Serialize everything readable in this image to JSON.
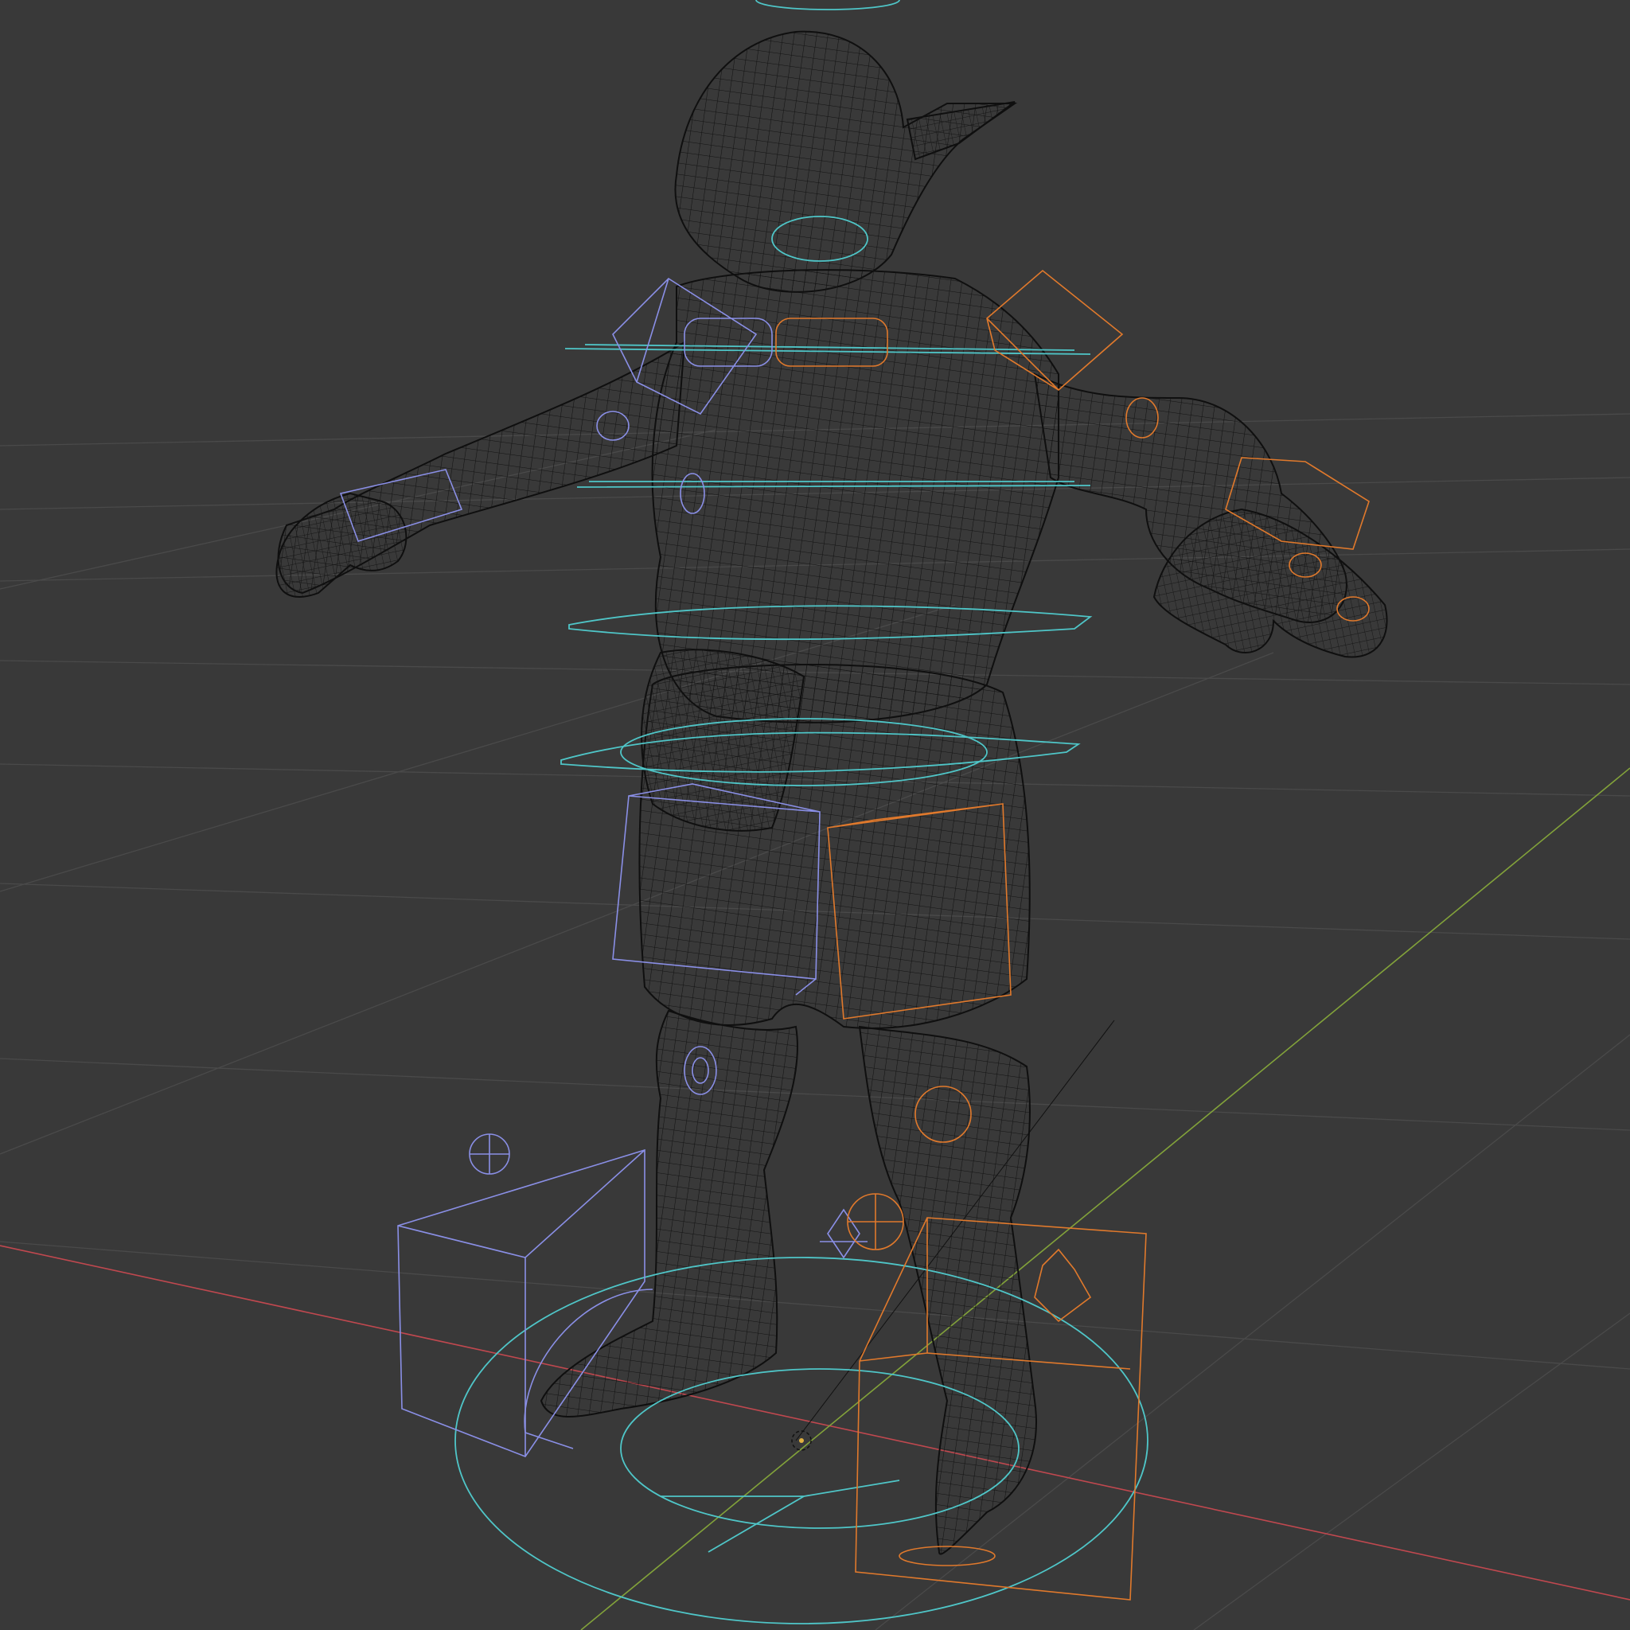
{
  "viewport": {
    "background_color": "#393939",
    "grid_color": "#4a4a4a",
    "x_axis_color": "#c0484f",
    "y_axis_color": "#82a23a",
    "view": "perspective",
    "shading": "wireframe"
  },
  "scene": {
    "mesh": {
      "name": "character-mesh",
      "wire_color": "#111111"
    },
    "armature": {
      "center_controls_color": "#4fc6c8",
      "left_side_controls_color": "#8a8fe6",
      "right_side_controls_color": "#e0792c"
    },
    "3d_cursor": {
      "visible": true
    }
  }
}
